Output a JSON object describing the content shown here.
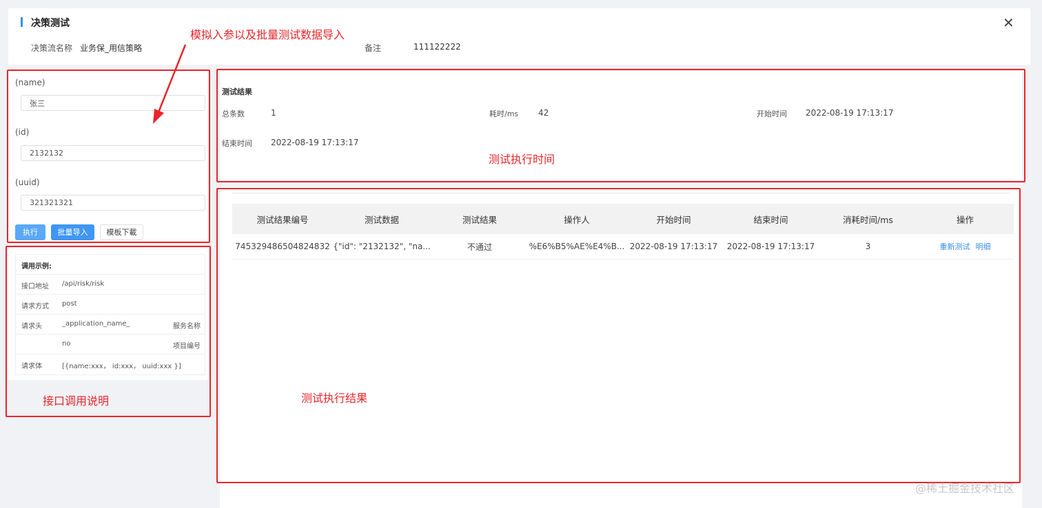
{
  "header": {
    "title": "决策测试",
    "flow_name_label": "决策流名称",
    "flow_name_value": "业务保_用信策略",
    "remark_label": "备注",
    "remark_value": "111122222",
    "close_glyph": "✕"
  },
  "inputs": {
    "fields": [
      {
        "label": "(name)",
        "value": "张三"
      },
      {
        "label": "(id)",
        "value": "2132132"
      },
      {
        "label": "(uuid)",
        "value": "321321321"
      }
    ],
    "buttons": {
      "execute": "执行",
      "batch_import": "批量导入",
      "template_download": "模板下載"
    }
  },
  "api_example": {
    "heading": "调用示例:",
    "rows": [
      {
        "key": "接口地址",
        "value": "/api/risk/risk",
        "extra": ""
      },
      {
        "key": "请求方式",
        "value": "post",
        "extra": ""
      },
      {
        "key": "请求头",
        "value": "_application_name_",
        "extra": "服务名称"
      },
      {
        "key": "",
        "value": "no",
        "extra": "项目编号"
      },
      {
        "key": "请求体",
        "value": "[{name:xxx， id:xxx， uuid:xxx }]",
        "extra": ""
      }
    ]
  },
  "test_result": {
    "heading": "测试结果",
    "total_label": "总条数",
    "total_value": "1",
    "elapsed_label": "耗时/ms",
    "elapsed_value": "42",
    "start_label": "开始时间",
    "start_value": "2022-08-19 17:13:17",
    "end_label": "结束时间",
    "end_value": "2022-08-19 17:13:17"
  },
  "results_table": {
    "columns": [
      "测试结果编号",
      "测试数据",
      "测试结果",
      "操作人",
      "开始时间",
      "结束时间",
      "消耗时间/ms",
      "操作"
    ],
    "rows": [
      {
        "id": "745329486504824832",
        "data": "{\"id\": \"2132132\", \"na...",
        "result": "不通过",
        "operator": "%E6%B5%AE%E4%B...",
        "start": "2022-08-19 17:13:17",
        "end": "2022-08-19 17:13:17",
        "cost": "3",
        "actions": {
          "retest": "重新测试",
          "detail": "明细"
        }
      }
    ]
  },
  "annotations": {
    "input_note": "模拟入参以及批量测试数据导入",
    "time_note": "测试执行时间",
    "api_note": "接口调用说明",
    "result_note": "测试执行结果"
  },
  "watermark": "@稀土掘金技术社区",
  "colors": {
    "accent": "#3a8ee6",
    "annotation": "#e8252a",
    "primary_button": "#5aa8f8"
  }
}
